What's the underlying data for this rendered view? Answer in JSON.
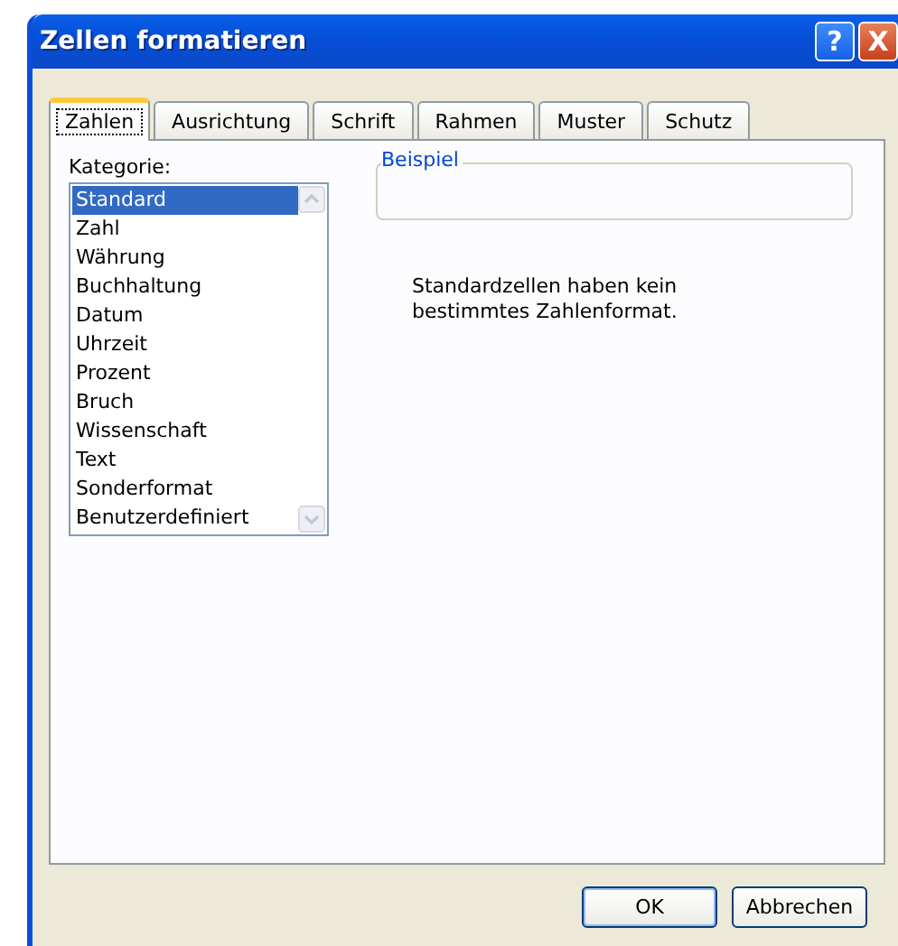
{
  "window": {
    "title": "Zellen formatieren"
  },
  "title_buttons": [
    "?",
    "X"
  ],
  "tabs": [
    {
      "label": "Zahlen",
      "selected": true
    },
    {
      "label": "Ausrichtung",
      "selected": false
    },
    {
      "label": "Schrift",
      "selected": false
    },
    {
      "label": "Rahmen",
      "selected": false
    },
    {
      "label": "Muster",
      "selected": false
    },
    {
      "label": "Schutz",
      "selected": false
    }
  ],
  "category": {
    "label": "Kategorie:",
    "items": [
      {
        "label": "Standard",
        "selected": true
      },
      {
        "label": "Zahl",
        "selected": false
      },
      {
        "label": "Währung",
        "selected": false
      },
      {
        "label": "Buchhaltung",
        "selected": false
      },
      {
        "label": "Datum",
        "selected": false
      },
      {
        "label": "Uhrzeit",
        "selected": false
      },
      {
        "label": "Prozent",
        "selected": false
      },
      {
        "label": "Bruch",
        "selected": false
      },
      {
        "label": "Wissenschaft",
        "selected": false
      },
      {
        "label": "Text",
        "selected": false
      },
      {
        "label": "Sonderformat",
        "selected": false
      },
      {
        "label": "Benutzerdefiniert",
        "selected": false
      }
    ]
  },
  "example": {
    "label": "Beispiel"
  },
  "description": "Standardzellen haben kein bestimmtes Zahlenformat.",
  "buttons": [
    "OK",
    "Abbrechen"
  ]
}
